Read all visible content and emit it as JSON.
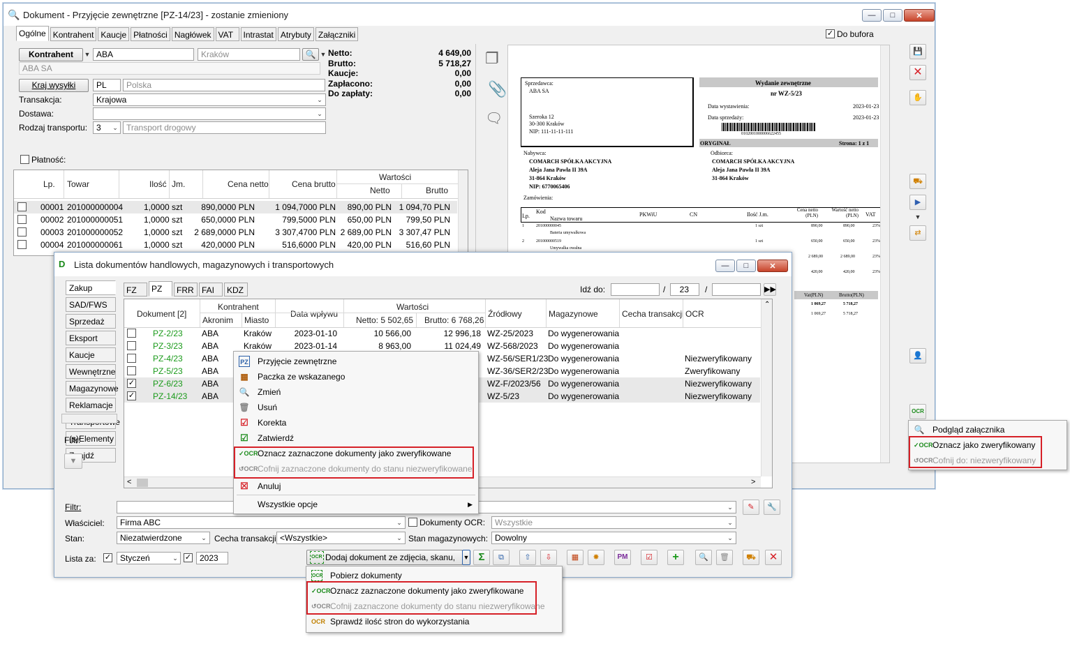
{
  "doc_window": {
    "title": "Dokument - Przyjęcie zewnętrzne [PZ-14/23]  - zostanie zmieniony",
    "tabs": [
      "Ogólne",
      "Kontrahent",
      "Kaucje",
      "Płatności",
      "Nagłówek",
      "VAT",
      "Intrastat",
      "Atrybuty",
      "Załączniki"
    ],
    "do_bufora": "Do bufora",
    "kontrahent_label": "Kontrahent",
    "kontrahent_code": "ABA",
    "kontrahent_city_placeholder": "Kraków",
    "kontrahent_name": "ABA SA",
    "kraj_wysylki_label": "Kraj wysyłki",
    "kraj_code": "PL",
    "kraj_name": "Polska",
    "transakcja_label": "Transakcja:",
    "transakcja_value": "Krajowa",
    "dostawa_label": "Dostawa:",
    "rodzaj_transportu_label": "Rodzaj transportu:",
    "rodzaj_transportu_code": "3",
    "rodzaj_transportu_value": "Transport drogowy",
    "platnosc_label": "Płatność:",
    "totals": [
      {
        "label": "Netto:",
        "value": "4 649,00"
      },
      {
        "label": "Brutto:",
        "value": "5 718,27"
      },
      {
        "label": "Kaucje:",
        "value": "0,00"
      },
      {
        "label": "Zapłacono:",
        "value": "0,00"
      },
      {
        "label": "Do zapłaty:",
        "value": "0,00"
      }
    ],
    "grid_headers": {
      "lp": "Lp.",
      "towar": "Towar",
      "ilosc": "Ilość",
      "jm": "Jm.",
      "cena_netto": "Cena netto",
      "cena_brutto": "Cena brutto",
      "wartosci": "Wartości",
      "netto": "Netto",
      "brutto": "Brutto"
    },
    "rows": [
      {
        "lp": "00001",
        "towar": "201000000004",
        "ilosc": "1,0000",
        "jm": "szt",
        "cn": "890,0000 PLN",
        "cb": "1 094,7000 PLN",
        "wn": "890,00 PLN",
        "wb": "1 094,70 PLN"
      },
      {
        "lp": "00002",
        "towar": "201000000051",
        "ilosc": "1,0000",
        "jm": "szt",
        "cn": "650,0000 PLN",
        "cb": "799,5000 PLN",
        "wn": "650,00 PLN",
        "wb": "799,50 PLN"
      },
      {
        "lp": "00003",
        "towar": "201000000052",
        "ilosc": "1,0000",
        "jm": "szt",
        "cn": "2 689,0000 PLN",
        "cb": "3 307,4700 PLN",
        "wn": "2 689,00 PLN",
        "wb": "3 307,47 PLN"
      },
      {
        "lp": "00004",
        "towar": "201000000061",
        "ilosc": "1,0000",
        "jm": "szt",
        "cn": "420,0000 PLN",
        "cb": "516,6000 PLN",
        "wn": "420,00 PLN",
        "wb": "516,60 PLN"
      }
    ]
  },
  "preview": {
    "sprzedawca_label": "Sprzedawca:",
    "sprzedawca_name": "ABA SA",
    "addr1": "Szeroka 12",
    "addr2": "30-300 Kraków",
    "nip": "NIP: 111-11-11-111",
    "doc_title": "Wydanie zewnętrzne",
    "doc_nr": "nr WZ-5/23",
    "data_wyst_label": "Data wystawienia:",
    "data_wyst": "2023-01-23",
    "data_sprz_label": "Data sprzedaży:",
    "data_sprz": "2023-01-23",
    "barcode_text": "0102001000006622455",
    "oryginal": "ORYGINAŁ",
    "strona": "Strona: 1 z 1",
    "nabywca_label": "Nabywca:",
    "odbiorca_label": "Odbiorca:",
    "firma": "COMARCH SPÓŁKA AKCYJNA",
    "ulica": "Aleja Jana Pawła II 39A",
    "miasto": "31-864  Kraków",
    "nip2": "NIP: 6770065406",
    "zamowienia": "Zamówienia:",
    "table_headers": [
      "Lp.",
      "Kod",
      "Nazwa towaru",
      "PKWiU",
      "CN",
      "Ilość J.m.",
      "Cena netto (PLN)",
      "Wartość netto (PLN)",
      "VAT"
    ],
    "r1": {
      "lp": "1",
      "kod": "201000000045",
      "nazwa": "Bateria umywalkowa",
      "ilosc": "1 szt",
      "cena": "890,00",
      "wart": "890,00",
      "vat": "23%"
    },
    "r2": {
      "lp": "2",
      "kod": "201000000519",
      "nazwa": "Umywalka owalna",
      "ilosc": "1 szt",
      "cena": "650,00",
      "wart": "650,00",
      "vat": "23%"
    },
    "extra1": {
      "cena": "2 689,00",
      "wart": "2 689,00",
      "vat": "23%"
    },
    "extra2": {
      "cena": "420,00",
      "wart": "420,00",
      "vat": "23%"
    },
    "vat_hdr": "Vat(PLN)",
    "brutto_hdr": "Brutto(PLN)",
    "vat_sum": "1 069,27",
    "brutto_sum": "5 718,27"
  },
  "right_menu": {
    "items": [
      "Podgląd załącznika",
      "Oznacz jako zweryfikowany",
      "Cofnij do: niezweryfikowany"
    ]
  },
  "list_window": {
    "title": "Lista dokumentów handlowych, magazynowych i transportowych",
    "side_tabs": [
      "Zakup",
      "SAD/FWS",
      "Sprzedaż",
      "Eksport",
      "Kaucje",
      "Wewnętrzne",
      "Magazynowe",
      "Reklamacje",
      "Transportowe",
      "(s)Elementy",
      "Znajdź"
    ],
    "doc_tabs": [
      "FZ",
      "PZ",
      "FRR",
      "FAI",
      "KDZ"
    ],
    "idz_do": "Idź do:",
    "idz_do_num": "23",
    "headers": {
      "dokument": "Dokument [2]",
      "kontrahent": "Kontrahent",
      "akronim": "Akronim",
      "miasto": "Miasto",
      "data": "Data wpływu",
      "wartosci": "Wartości",
      "netto": "Netto: 5 502,65",
      "brutto": "Brutto: 6 768,26",
      "zrodlowy": "Źródłowy",
      "magazynowe": "Magazynowe",
      "cecha": "Cecha transakcji",
      "ocr": "OCR"
    },
    "rows": [
      {
        "checked": false,
        "doc": "PZ-2/23",
        "akronim": "ABA",
        "miasto": "Kraków",
        "data": "2023-01-10",
        "netto": "10 566,00",
        "brutto": "12 996,18",
        "zrodlowy": "WZ-25/2023",
        "mag": "Do wygenerowania",
        "ocr": ""
      },
      {
        "checked": false,
        "doc": "PZ-3/23",
        "akronim": "ABA",
        "miasto": "Kraków",
        "data": "2023-01-14",
        "netto": "8 963,00",
        "brutto": "11 024,49",
        "zrodlowy": "WZ-568/2023",
        "mag": "Do wygenerowania",
        "ocr": ""
      },
      {
        "checked": false,
        "doc": "PZ-4/23",
        "akronim": "ABA",
        "miasto": "",
        "data": "",
        "netto": "",
        "brutto": "",
        "zrodlowy": "WZ-56/SER1/23",
        "mag": "Do wygenerowania",
        "ocr": "Niezweryfikowany"
      },
      {
        "checked": false,
        "doc": "PZ-5/23",
        "akronim": "ABA",
        "miasto": "",
        "data": "",
        "netto": "",
        "brutto": "",
        "zrodlowy": "WZ-36/SER2/23",
        "mag": "Do wygenerowania",
        "ocr": "Zweryfikowany"
      },
      {
        "checked": true,
        "doc": "PZ-6/23",
        "akronim": "ABA",
        "miasto": "",
        "data": "",
        "netto": "",
        "brutto": "",
        "zrodlowy": "WZ-F/2023/56",
        "mag": "Do wygenerowania",
        "ocr": "Niezweryfikowany"
      },
      {
        "checked": true,
        "doc": "PZ-14/23",
        "akronim": "ABA",
        "miasto": "",
        "data": "",
        "netto": "",
        "brutto": "",
        "zrodlowy": "WZ-5/23",
        "mag": "Do wygenerowania",
        "ocr": "Niezweryfikowany"
      }
    ],
    "filtr_left": "Filtr:",
    "filtr": "Filtr:",
    "wlasciciel": "Właściciel:",
    "wlasciciel_value": "Firma ABC",
    "dokumenty_ocr": "Dokumenty OCR:",
    "dokumenty_ocr_value": "Wszystkie",
    "stan": "Stan:",
    "stan_value": "Niezatwierdzone",
    "cecha": "Cecha transakcji:",
    "cecha_value": "<Wszystkie>",
    "stan_mag": "Stan magazynowych:",
    "stan_mag_value": "Dowolny",
    "lista_za": "Lista za:",
    "miesiac": "Styczeń",
    "rok": "2023",
    "dodaj_ocr": "Dodaj dokument ze zdjęcia, skanu, PDF"
  },
  "context_menu": {
    "items": [
      "Przyjęcie zewnętrzne",
      "Paczka ze wskazanego",
      "Zmień",
      "Usuń",
      "Korekta",
      "Zatwierdź",
      "Oznacz zaznaczone dokumenty jako zweryfikowane",
      "Cofnij zaznaczone dokumenty do stanu niezweryfikowane",
      "Anuluj",
      "Wszystkie opcje"
    ]
  },
  "ocr_menu": {
    "items": [
      "Pobierz dokumenty",
      "Oznacz zaznaczone dokumenty jako zweryfikowane",
      "Cofnij zaznaczone dokumenty do stanu niezweryfikowane",
      "Sprawdź ilość stron do wykorzystania"
    ]
  },
  "colors": {
    "red_box": "#d62027",
    "green_doc": "#1a9a1a",
    "accent": "#3a6fb3"
  }
}
